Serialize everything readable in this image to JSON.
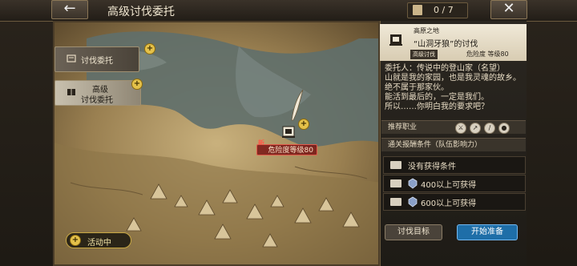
{
  "header": {
    "back_icon": "back-arrow-icon",
    "title": "高级讨伐委托",
    "counter_icon": "ticket-icon",
    "counter_text": "0 / 7",
    "close_icon": "close-icon"
  },
  "tabs": [
    {
      "label": "讨伐委托",
      "icon": "scroll-icon",
      "active": false
    },
    {
      "label_line1": "高级",
      "label_line2": "讨伐委托",
      "icon": "book-icon",
      "active": true
    }
  ],
  "map": {
    "marker_icon": "quest-marker-icon",
    "new_label": "新",
    "danger_label": "危险度等级80"
  },
  "event_button": {
    "label": "活动中"
  },
  "quest": {
    "region": "高原之地",
    "title": "“山洞牙狼”的讨伐",
    "badge": "高级讨伐",
    "danger_label": "危险度",
    "level_label": "等级80"
  },
  "story": {
    "line1": "委托人：传说中的登山家（名望）",
    "line2": "山就是我的家园，也是我灵魂的故乡。",
    "line3": "绝不属于那家伙。",
    "line4": "能活到最后的，一定是我们。",
    "line5": "所以……你明白我的要求吧？"
  },
  "recommended": {
    "label": "推荐职业",
    "icons": [
      "sword-icon",
      "dagger-icon",
      "staff-icon",
      "brain-icon"
    ]
  },
  "rewards": {
    "label": "通关报酬条件（队伍影响力）",
    "items": [
      {
        "text": "没有获得条件"
      },
      {
        "text": "400以上可获得"
      },
      {
        "text": "600以上可获得"
      }
    ]
  },
  "buttons": {
    "goal": "讨伐目标",
    "start": "开始准备"
  },
  "colors": {
    "accent_gold": "#e4c14a",
    "start_blue": "#1e6ea8",
    "danger_red": "#e05a4a"
  }
}
